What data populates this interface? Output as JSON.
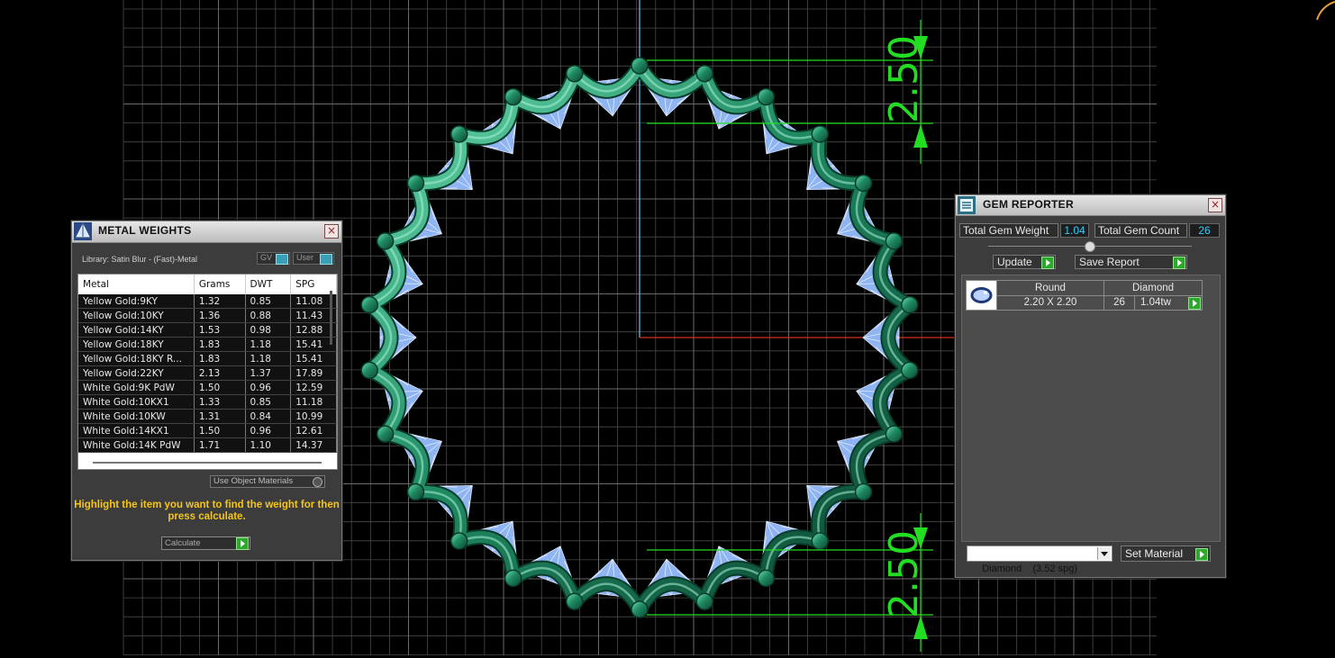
{
  "viewport": {
    "dimension_top": "2.50",
    "dimension_bottom": "2.50",
    "colors": {
      "metal": "#1f8a62",
      "gem": "#8fb4f2",
      "grid": "#4a4a4a",
      "dimension": "#22dd22"
    }
  },
  "metal_weights": {
    "title": "METAL WEIGHTS",
    "library": "Library: Satin Blur - (Fast)-Metal",
    "gv_label": "GV",
    "user_label": "User",
    "columns": [
      "Metal",
      "Grams",
      "DWT",
      "SPG"
    ],
    "rows": [
      [
        "Yellow Gold:9KY",
        "1.32",
        "0.85",
        "11.08"
      ],
      [
        "Yellow Gold:10KY",
        "1.36",
        "0.88",
        "11.43"
      ],
      [
        "Yellow Gold:14KY",
        "1.53",
        "0.98",
        "12.88"
      ],
      [
        "Yellow Gold:18KY",
        "1.83",
        "1.18",
        "15.41"
      ],
      [
        "Yellow Gold:18KY R...",
        "1.83",
        "1.18",
        "15.41"
      ],
      [
        "Yellow Gold:22KY",
        "2.13",
        "1.37",
        "17.89"
      ],
      [
        "White Gold:9K PdW",
        "1.50",
        "0.96",
        "12.59"
      ],
      [
        "White Gold:10KX1",
        "1.33",
        "0.85",
        "11.18"
      ],
      [
        "White Gold:10KW",
        "1.31",
        "0.84",
        "10.99"
      ],
      [
        "White Gold:14KX1",
        "1.50",
        "0.96",
        "12.61"
      ],
      [
        "White Gold:14K PdW",
        "1.71",
        "1.10",
        "14.37"
      ]
    ],
    "use_object_materials": "Use Object Materials",
    "hint": "Highlight the item you want to find the weight for then press calculate.",
    "calculate": "Calculate"
  },
  "gem_reporter": {
    "title": "GEM REPORTER",
    "total_weight_label": "Total Gem Weight",
    "total_weight_value": "1.04",
    "total_count_label": "Total Gem Count",
    "total_count_value": "26",
    "update": "Update",
    "save_report": "Save Report",
    "gem_row": {
      "shape": "Round",
      "material": "Diamond",
      "size": "2.20 X 2.20",
      "count": "26",
      "weight": "1.04tw"
    },
    "material_select": "Diamond    (3.52 spg)",
    "set_material": "Set Material"
  }
}
